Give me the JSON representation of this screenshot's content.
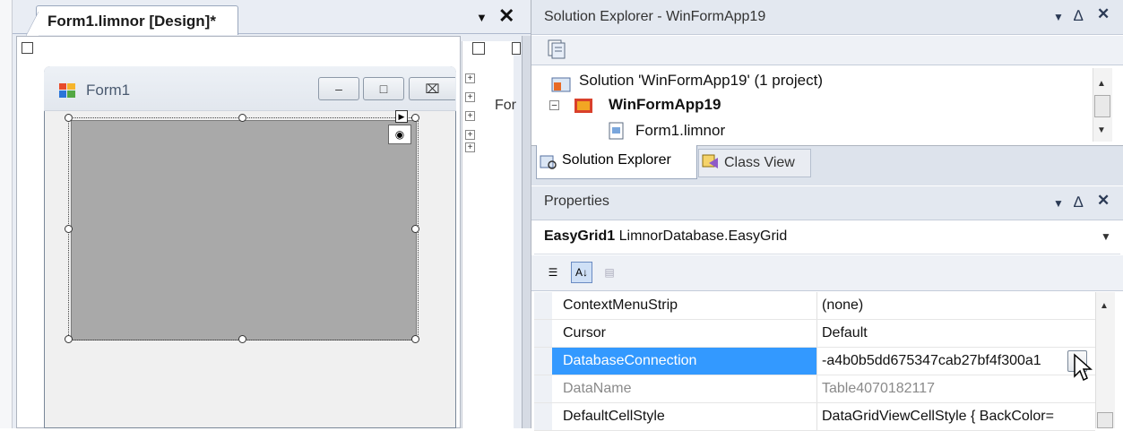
{
  "designer": {
    "tab_title": "Form1.limnor [Design]*",
    "tab_dropdown_icon": "dropdown-triangle",
    "tab_close_icon": "close-x",
    "form": {
      "title": "Form1",
      "min_glyph": "–",
      "max_glyph": "□",
      "close_glyph": "⌧"
    },
    "component_tree_label": "For"
  },
  "solution_explorer": {
    "title": "Solution Explorer - WinFormApp19",
    "pin_glyph": "4",
    "tree": [
      {
        "label": "Solution 'WinFormApp19' (1 project)",
        "bold": false
      },
      {
        "label": "WinFormApp19",
        "bold": true
      },
      {
        "label": "Form1.limnor",
        "bold": false
      }
    ],
    "tabs": [
      "Solution Explorer",
      "Class View"
    ]
  },
  "properties": {
    "title": "Properties",
    "object_name": "EasyGrid1",
    "object_type": "LimnorDatabase.EasyGrid",
    "rows": [
      {
        "name": "ContextMenuStrip",
        "value": "(none)"
      },
      {
        "name": "Cursor",
        "value": "Default"
      },
      {
        "name": "DatabaseConnection",
        "value": "-a4b0b5dd675347cab27bf4f300a1"
      },
      {
        "name": "DataName",
        "value": "Table4070182117"
      },
      {
        "name": "DefaultCellStyle",
        "value": "DataGridViewCellStyle { BackColor="
      }
    ],
    "selected_row": "DatabaseConnection"
  },
  "colors": {
    "selection": "#3399ff",
    "panel_title": "#e3e8f0",
    "grid_fill": "#a9a9a9"
  }
}
